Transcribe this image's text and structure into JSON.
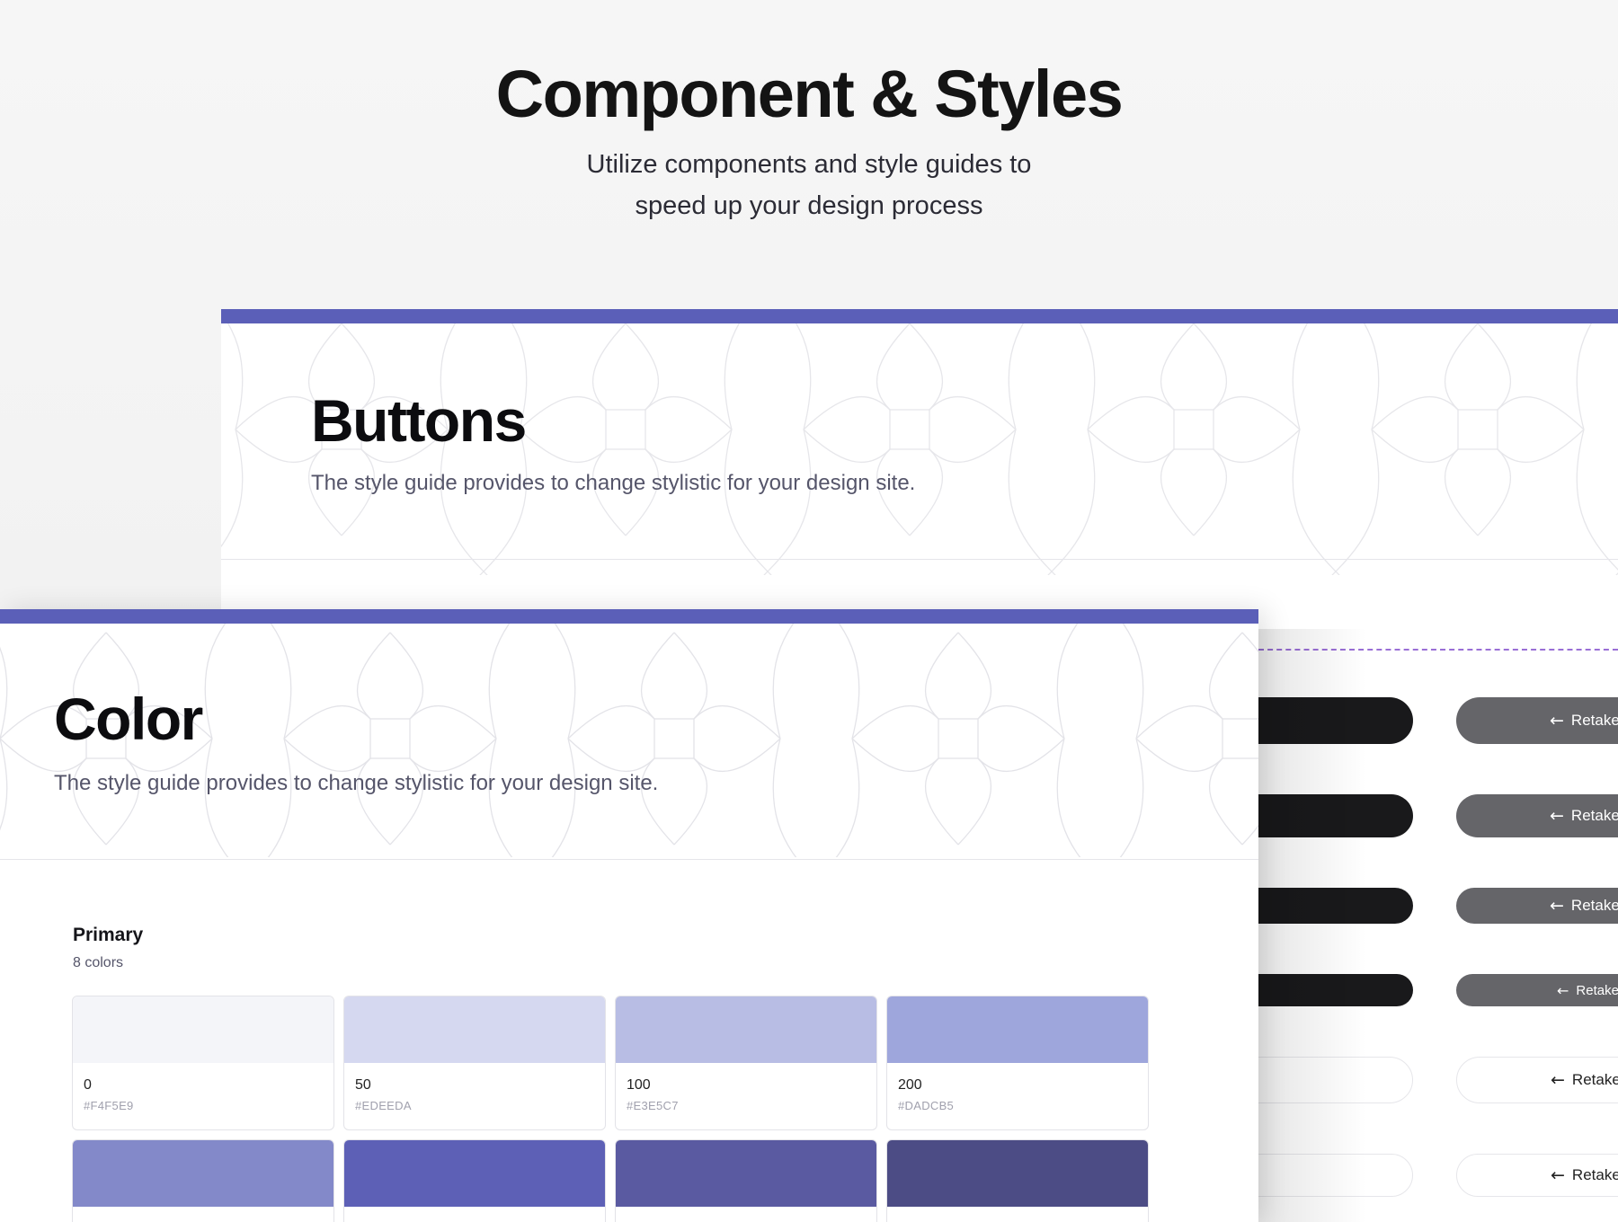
{
  "hero": {
    "title": "Component & Styles",
    "subtitle_line1": "Utilize components and style guides to",
    "subtitle_line2": "speed up your design process"
  },
  "colors": {
    "accent_bar": "#5b5fb8",
    "dashed_guide": "#9a6fd6",
    "button_dark": "#19191b",
    "button_gray": "#656569"
  },
  "buttons_section": {
    "title": "Buttons",
    "description": "The style guide provides to change stylistic for your design site.",
    "button_label": "Retake",
    "button_icon": "arrow-left-icon"
  },
  "color_section": {
    "title": "Color",
    "description": "The style guide provides to change stylistic for your design site.",
    "group": {
      "title": "Primary",
      "count": "8 colors",
      "swatches": [
        {
          "name": "0",
          "hex": "#F4F5E9",
          "color": "#f4f5f9"
        },
        {
          "name": "50",
          "hex": "#EDEEDA",
          "color": "#d5d8f0"
        },
        {
          "name": "100",
          "hex": "#E3E5C7",
          "color": "#b8bde4"
        },
        {
          "name": "200",
          "hex": "#DADCB5",
          "color": "#9ea6dc"
        },
        {
          "name": "",
          "hex": "",
          "color": "#8389c9"
        },
        {
          "name": "",
          "hex": "",
          "color": "#5d60b6"
        },
        {
          "name": "",
          "hex": "",
          "color": "#5a5aa1"
        },
        {
          "name": "",
          "hex": "",
          "color": "#4c4c85"
        }
      ]
    }
  }
}
